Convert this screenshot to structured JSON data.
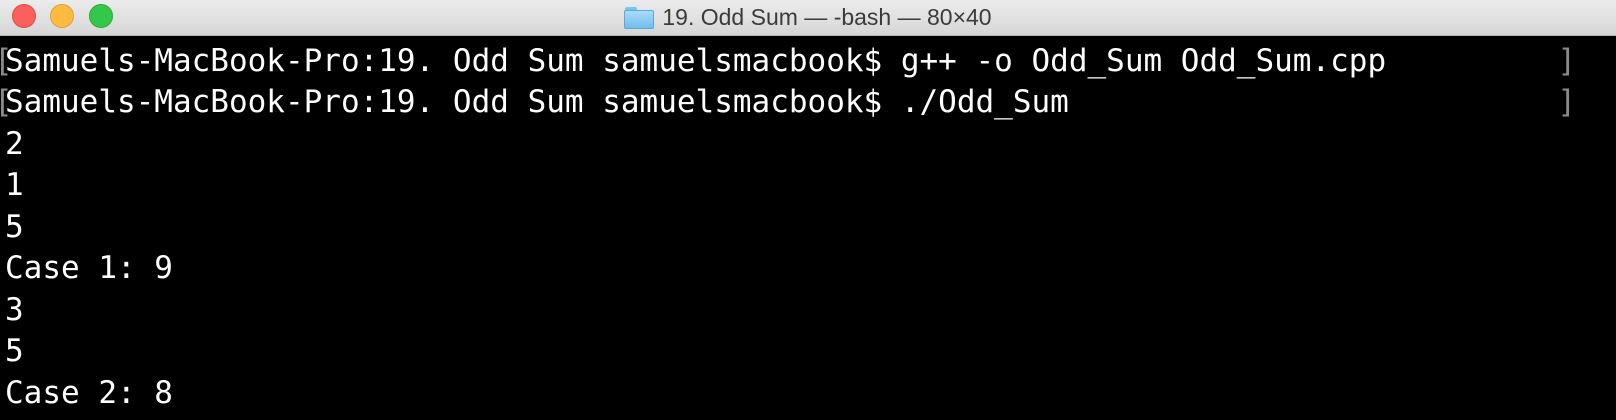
{
  "window": {
    "title": "19. Odd Sum — -bash — 80×40"
  },
  "icons": {
    "folder": "folder-icon",
    "close": "close-icon",
    "minimize": "minimize-icon",
    "zoom": "zoom-icon"
  },
  "colors": {
    "background": "#000000",
    "text": "#ffffff",
    "close": "#fc605c",
    "minimize": "#fdbc40",
    "zoom": "#34c84a"
  },
  "terminal": {
    "lines": [
      "Samuels-MacBook-Pro:19. Odd Sum samuelsmacbook$ g++ -o Odd_Sum Odd_Sum.cpp",
      "Samuels-MacBook-Pro:19. Odd Sum samuelsmacbook$ ./Odd_Sum",
      "2",
      "1",
      "5",
      "Case 1: 9",
      "3",
      "5",
      "Case 2: 8"
    ]
  }
}
